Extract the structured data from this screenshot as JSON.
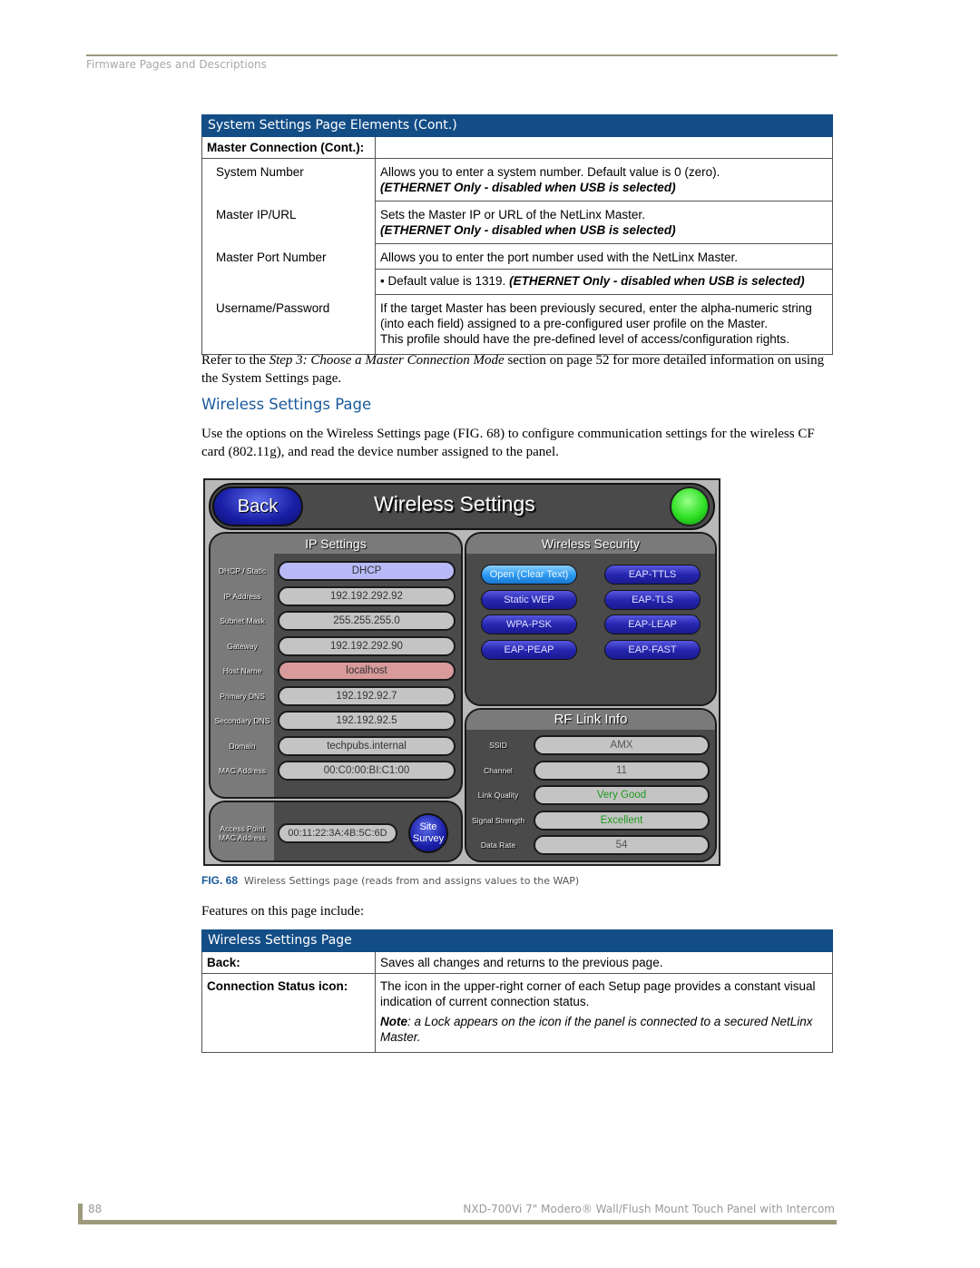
{
  "header": {
    "section": "Firmware Pages and Descriptions"
  },
  "table1": {
    "title": "System Settings Page Elements (Cont.)",
    "group": "Master Connection (Cont.):",
    "rows": [
      {
        "label": "System Number",
        "lines": [
          "Allows you to enter a system number. Default value is 0 (zero)."
        ],
        "note": "(ETHERNET Only - disabled when USB is selected)"
      },
      {
        "label": "Master IP/URL",
        "lines": [
          "Sets the Master IP or URL of the NetLinx Master."
        ],
        "note": "(ETHERNET Only - disabled when USB is selected)"
      },
      {
        "label": "Master Port Number",
        "lines": [
          "Allows you to enter the port number used with the NetLinx Master."
        ],
        "bullet": "• Default value is 1319.",
        "note": "(ETHERNET Only - disabled when USB is selected)"
      },
      {
        "label": "Username/Password",
        "lines": [
          "If the target Master has been previously secured, enter the alpha-numeric string (into each field) assigned to a pre-configured user profile on the Master.",
          "This profile should have the pre-defined level of access/configuration rights."
        ]
      }
    ]
  },
  "refer": {
    "pre": "Refer to the ",
    "italic": "Step 3: Choose a Master Connection Mode",
    "post": " section on page 52 for more detailed information on using the System Settings page."
  },
  "section_heading": "Wireless Settings Page",
  "intro": "Use the options on the Wireless Settings page (FIG. 68) to configure communication settings for the wireless CF card (802.11g), and read the device number assigned to the panel.",
  "panel": {
    "back": "Back",
    "title": "Wireless Settings",
    "status_color": "#2ee024",
    "ip_settings": {
      "title": "IP Settings",
      "fields": [
        {
          "label": "DHCP / Static",
          "value": "DHCP",
          "color": "#b8baf8"
        },
        {
          "label": "IP Address",
          "value": "192.192.292.92",
          "color": "#c4c4c4"
        },
        {
          "label": "Subnet Mask",
          "value": "255.255.255.0",
          "color": "#c4c4c4"
        },
        {
          "label": "Gateway",
          "value": "192.192.292.90",
          "color": "#c4c4c4"
        },
        {
          "label": "Host Name",
          "value": "localhost",
          "color": "#d89a9a"
        },
        {
          "label": "Primary DNS",
          "value": "192.192.92.7",
          "color": "#c4c4c4"
        },
        {
          "label": "Secondary DNS",
          "value": "192.192.92.5",
          "color": "#c4c4c4"
        },
        {
          "label": "Domain",
          "value": "techpubs.internal",
          "color": "#c4c4c4"
        },
        {
          "label": "MAC Address",
          "value": "00:C0:00:BI:C1:00",
          "color": "#c4c4c4"
        }
      ],
      "ap_label": "Access Point MAC Address",
      "ap_value": "00:11:22:3A:4B:5C:6D",
      "site_survey": "Site Survey"
    },
    "wireless_security": {
      "title": "Wireless Security",
      "options": [
        "Open (Clear Text)",
        "EAP-TTLS",
        "Static WEP",
        "EAP-TLS",
        "WPA-PSK",
        "EAP-LEAP",
        "EAP-PEAP",
        "EAP-FAST"
      ],
      "selected": "Open (Clear Text)"
    },
    "rf_link": {
      "title": "RF Link Info",
      "fields": [
        {
          "label": "SSID",
          "value": "AMX",
          "color": "#555555"
        },
        {
          "label": "Channel",
          "value": "11",
          "color": "#555555"
        },
        {
          "label": "Link Quality",
          "value": "Very Good",
          "color": "#1e9a1e"
        },
        {
          "label": "Signal Strength",
          "value": "Excellent",
          "color": "#1e9a1e"
        },
        {
          "label": "Data Rate",
          "value": "54",
          "color": "#555555"
        }
      ]
    }
  },
  "figure": {
    "num": "FIG. 68",
    "caption": "Wireless Settings page (reads from and assigns values to the WAP)"
  },
  "features_intro": "Features on this page include:",
  "table2": {
    "title": "Wireless Settings Page",
    "rows": [
      {
        "label": "Back:",
        "text": "Saves all changes and returns to the previous page."
      },
      {
        "label": "Connection Status icon:",
        "text": "The icon in the upper-right corner of each Setup page provides a constant visual indication of current connection status.",
        "note_label": "Note",
        "note": ": a Lock appears on the icon if the panel is connected to a secured NetLinx Master."
      }
    ]
  },
  "footer": {
    "page": "88",
    "product": "NXD-700Vi 7\" Modero® Wall/Flush Mount Touch Panel with Intercom"
  }
}
